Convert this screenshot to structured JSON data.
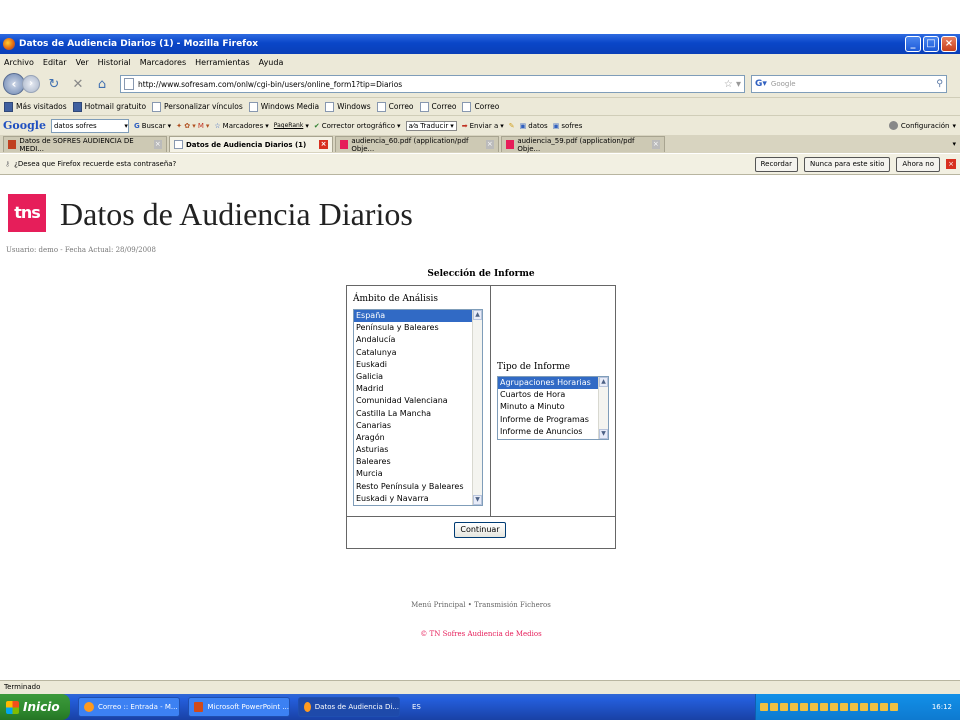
{
  "window": {
    "title": "Datos de Audiencia Diarios (1) - Mozilla Firefox"
  },
  "menu": [
    "Archivo",
    "Editar",
    "Ver",
    "Historial",
    "Marcadores",
    "Herramientas",
    "Ayuda"
  ],
  "nav": {
    "url": "http://www.sofresam.com/onlw/cgi-bin/users/online_form1?tip=Diarios",
    "search_placeholder": "Google"
  },
  "bookmarks": [
    "Más visitados",
    "Hotmail gratuito",
    "Personalizar vínculos",
    "Windows Media",
    "Windows",
    "Correo",
    "Correo",
    "Correo"
  ],
  "google_toolbar": {
    "logo": "Google",
    "search_value": "datos sofres",
    "items": [
      "Buscar",
      "Marcadores",
      "PageRank",
      "Corrector ortográfico",
      "Traducir",
      "Enviar a",
      "datos",
      "sofres"
    ],
    "config": "Configuración"
  },
  "tabs": [
    {
      "label": "Datos de SOFRES AUDIENCIA DE MEDI...",
      "active": false
    },
    {
      "label": "Datos de Audiencia Diarios (1)",
      "active": true
    },
    {
      "label": "audiencia_60.pdf (application/pdf Obje...",
      "active": false
    },
    {
      "label": "audiencia_59.pdf (application/pdf Obje...",
      "active": false
    }
  ],
  "notification": {
    "text": "¿Desea que Firefox recuerde esta contraseña?",
    "recordar": "Recordar",
    "nunca": "Nunca para este sitio",
    "ahora_no": "Ahora no"
  },
  "page": {
    "logo_text": "tns",
    "title": "Datos de Audiencia Diarios",
    "user_info": "Usuario: demo - Fecha Actual: 28/09/2008",
    "form_title": "Selección de Informe",
    "ambito_label": "Ámbito de Análisis",
    "ambito_options": [
      "España",
      "Península y Baleares",
      "Andalucía",
      "Catalunya",
      "Euskadi",
      "Galicia",
      "Madrid",
      "Comunidad Valenciana",
      "Castilla La Mancha",
      "Canarias",
      "Aragón",
      "Asturias",
      "Baleares",
      "Murcia",
      "Resto Península y Baleares",
      "Euskadi y Navarra"
    ],
    "ambito_selected": "España",
    "tipo_label": "Tipo de Informe",
    "tipo_options": [
      "Agrupaciones Horarias",
      "Cuartos de Hora",
      "Minuto a Minuto",
      "Informe de Programas",
      "Informe de Anuncios"
    ],
    "tipo_selected": "Agrupaciones Horarias",
    "continue_label": "Continuar",
    "footer_links": "Menú Principal • Transmisión Ficheros",
    "copyright": "© TN Sofres Audiencia de Medios"
  },
  "status": "Terminado",
  "taskbar": {
    "start": "Inicio",
    "tasks": [
      {
        "label": "Correo :: Entrada - M...",
        "active": false
      },
      {
        "label": "Microsoft PowerPoint ...",
        "active": false
      },
      {
        "label": "Datos de Audiencia Di...",
        "active": true
      }
    ],
    "lang": "ES",
    "clock": "16:12"
  }
}
